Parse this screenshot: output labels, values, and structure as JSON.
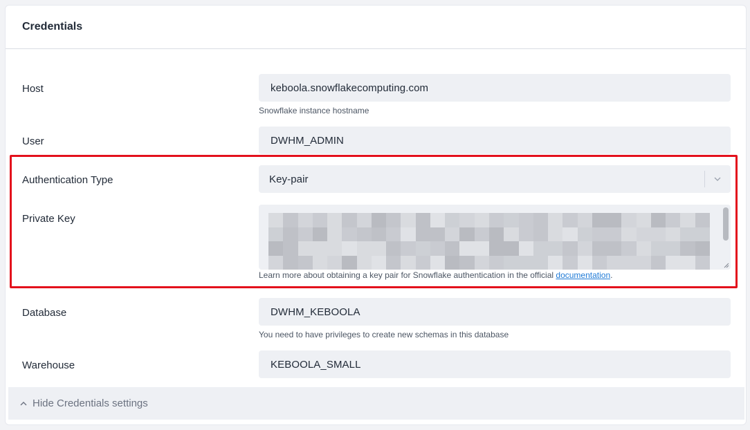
{
  "card": {
    "title": "Credentials"
  },
  "host": {
    "label": "Host",
    "value": "keboola.snowflakecomputing.com",
    "help": "Snowflake instance hostname"
  },
  "user": {
    "label": "User",
    "value": "DWHM_ADMIN"
  },
  "auth_type": {
    "label": "Authentication Type",
    "value": "Key-pair"
  },
  "private_key": {
    "label": "Private Key",
    "help_prefix": "Learn more about obtaining a key pair for Snowflake authentication in the official ",
    "help_link": "documentation",
    "help_suffix": "."
  },
  "database": {
    "label": "Database",
    "value": "DWHM_KEBOOLA",
    "help": "You need to have privileges to create new schemas in this database"
  },
  "warehouse": {
    "label": "Warehouse",
    "value": "KEBOOLA_SMALL"
  },
  "footer": {
    "toggle_label": "Hide Credentials settings"
  },
  "colors": {
    "highlight_border": "#e3101c",
    "link": "#1f7ad6",
    "field_bg": "#eef0f4"
  }
}
